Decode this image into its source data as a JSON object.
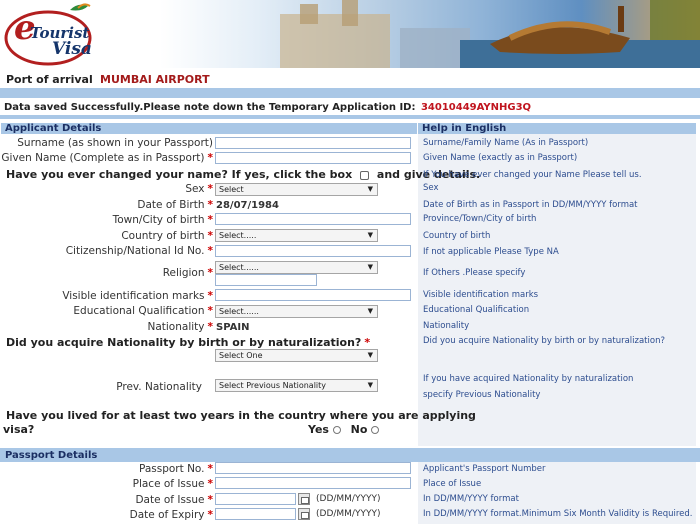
{
  "header": {
    "logo_e": "e",
    "logo_tourist": "Tourist",
    "logo_visa": "Visa"
  },
  "port": {
    "label": "Port of arrival",
    "value": "MUMBAI AIRPORT"
  },
  "saved": {
    "message": "Data saved Successfully.Please note down the Temporary Application ID:",
    "app_id": "34010449AYNHG3Q"
  },
  "applicant": {
    "section_title": "Applicant Details",
    "help_title": "Help in English",
    "surname_label": "Surname (as shown in your Passport)",
    "given_name_label": "Given Name (Complete as in Passport)",
    "changed_name_q": "Have you ever changed your name? If yes, click the box",
    "changed_name_q2": "and give details.",
    "sex_label": "Sex",
    "sex_select": "Select",
    "dob_label": "Date of Birth",
    "dob_value": "28/07/1984",
    "town_label": "Town/City of birth",
    "country_label": "Country of birth",
    "country_select": "Select.....",
    "citizenship_label": "Citizenship/National Id No.",
    "religion_label": "Religion",
    "religion_select": "Select......",
    "visible_marks_label": "Visible identification marks",
    "education_label": "Educational Qualification",
    "education_select": "Select......",
    "nationality_label": "Nationality",
    "nationality_value": "SPAIN",
    "acquire_q": "Did you acquire Nationality by birth or by naturalization?",
    "acquire_select": "Select One",
    "prev_nat_label": "Prev. Nationality",
    "prev_nat_select": "Select Previous Nationality",
    "lived_q1": "Have you lived for at least two years in the country where you are applying",
    "lived_q2": "visa?",
    "yes_label": "Yes",
    "no_label": "No",
    "star": "*"
  },
  "help": {
    "surname": "Surname/Family Name (As in Passport)",
    "given": "Given Name (exactly as in Passport)",
    "changed": "If You have ever changed your Name Please tell us.",
    "sex": "Sex",
    "dob": "Date of Birth as in Passport in DD/MM/YYYY format",
    "town": "Province/Town/City of birth",
    "country": "Country of birth",
    "citizenship": "If not applicable Please Type NA",
    "religion": "If Others .Please specify",
    "marks": "Visible identification marks",
    "education": "Educational Qualification",
    "nationality": "Nationality",
    "acquire": "Did you acquire Nationality by birth or by naturalization?",
    "prev1": "If you have acquired Nationality by naturalization",
    "prev2": "specify Previous Nationality"
  },
  "passport": {
    "section_title": "Passport Details",
    "no_label": "Passport No.",
    "place_label": "Place of Issue",
    "issue_label": "Date of Issue",
    "expiry_label": "Date of Expiry",
    "date_format": "(DD/MM/YYYY)",
    "help_no": "Applicant's Passport Number",
    "help_place": "Place of Issue",
    "help_issue": "In DD/MM/YYYY format",
    "help_expiry": "In DD/MM/YYYY format.Minimum Six Month Validity is Required."
  },
  "colors": {
    "accent_red": "#a31b1b",
    "section_blue": "#a9c7e6",
    "help_text": "#2d4d8f"
  }
}
